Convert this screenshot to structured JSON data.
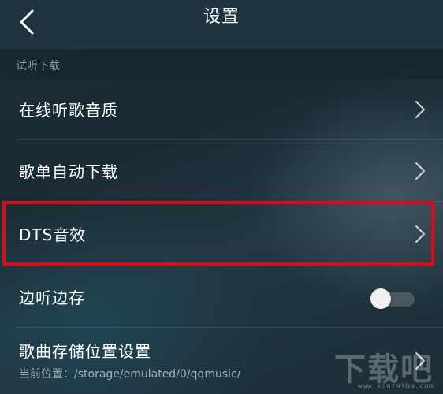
{
  "header": {
    "title": "设置",
    "back_icon": "chevron-left-icon"
  },
  "section": {
    "label": "试听下载"
  },
  "items": [
    {
      "label": "在线听歌音质",
      "icon": "chevron-right-icon"
    },
    {
      "label": "歌单自动下载",
      "icon": "chevron-right-icon"
    },
    {
      "label": "DTS音效",
      "icon": "chevron-right-icon",
      "highlighted": true
    },
    {
      "label": "边听边存",
      "toggle": false
    },
    {
      "label": "歌曲存储位置设置",
      "sublabel": "当前位置：/storage/emulated/0/qqmusic/",
      "icon": "chevron-right-icon"
    }
  ],
  "watermark": {
    "text": "下载吧",
    "url": "www.xiazaiba.com"
  },
  "colors": {
    "highlight": "#e00a14",
    "text": "#ffffff",
    "section_label": "#8fa0a8"
  }
}
